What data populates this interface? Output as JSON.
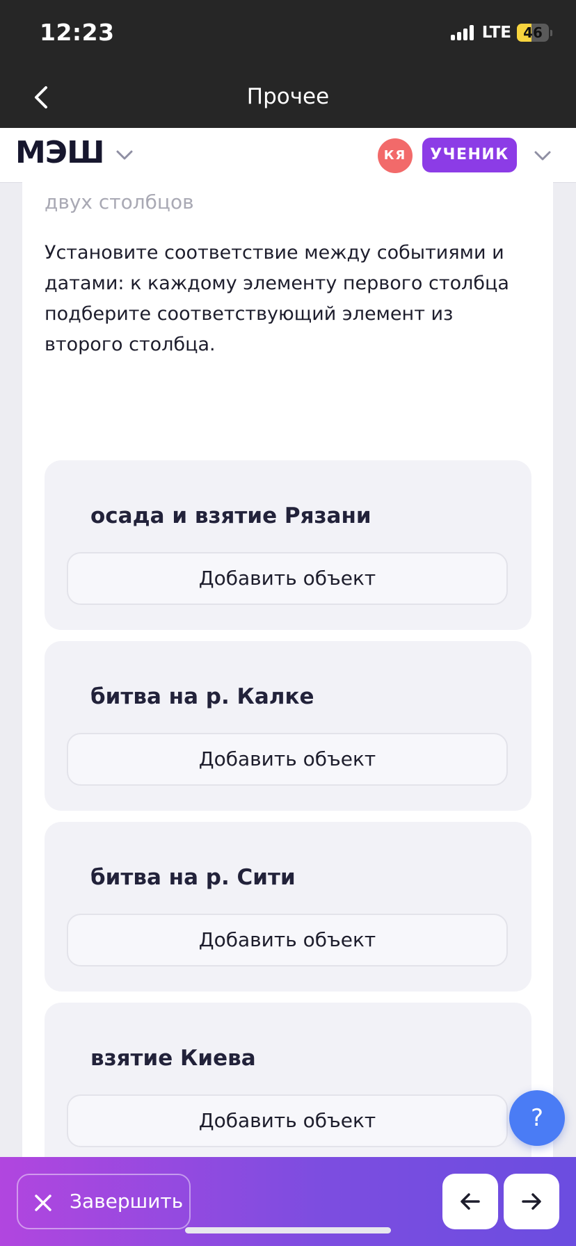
{
  "status_bar": {
    "time": "12:23",
    "network": "LTE",
    "battery": "46",
    "battery_level": 0.46
  },
  "nav": {
    "title": "Прочее"
  },
  "header": {
    "logo": "МЭШ",
    "avatar_initials": "КЯ",
    "role": "УЧЕНИК",
    "colors": {
      "avatar": "#f26a6a",
      "role_badge": "#8c3ce6"
    }
  },
  "task": {
    "subtitle": "двух столбцов",
    "instruction": "Установите соответствие между событиями и датами: к каждому элементу первого столбца подберите соответствующий элемент из второго столбца.",
    "items": [
      {
        "title": "осада и взятие Рязани",
        "button": "Добавить объект"
      },
      {
        "title": "битва на р. Калке",
        "button": "Добавить объект"
      },
      {
        "title": "битва на р. Сити",
        "button": "Добавить объект"
      },
      {
        "title": "взятие Киева",
        "button": "Добавить объект"
      }
    ]
  },
  "help": {
    "label": "?",
    "color": "#4a7cf5"
  },
  "bottom_bar": {
    "finish_label": "Завершить",
    "prev_icon": "arrow-left-icon",
    "next_icon": "arrow-right-icon"
  }
}
